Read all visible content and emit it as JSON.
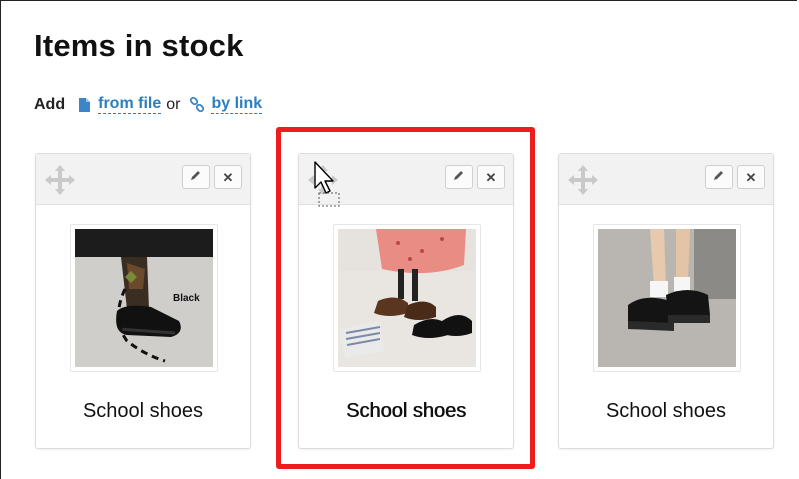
{
  "page": {
    "title": "Items in stock"
  },
  "add_bar": {
    "label": "Add",
    "from_file": "from file",
    "or": "or",
    "by_link": "by link",
    "file_icon": "file-icon",
    "link_icon": "link-icon"
  },
  "items": [
    {
      "caption": "School shoes",
      "image_text": "Black",
      "selected": false,
      "move_icon": "move-icon",
      "edit_icon": "pencil-icon",
      "delete_icon": "close-icon"
    },
    {
      "caption": "School shoes",
      "image_text": "",
      "selected": true,
      "move_icon": "move-icon",
      "edit_icon": "pencil-icon",
      "delete_icon": "close-icon"
    },
    {
      "caption": "School shoes",
      "image_text": "",
      "selected": false,
      "move_icon": "move-icon",
      "edit_icon": "pencil-icon",
      "delete_icon": "close-icon"
    }
  ],
  "delete_glyph": "✕",
  "colors": {
    "link": "#2a7fc1",
    "highlight": "#ee1c1c",
    "card_header": "#f2f2f2"
  }
}
